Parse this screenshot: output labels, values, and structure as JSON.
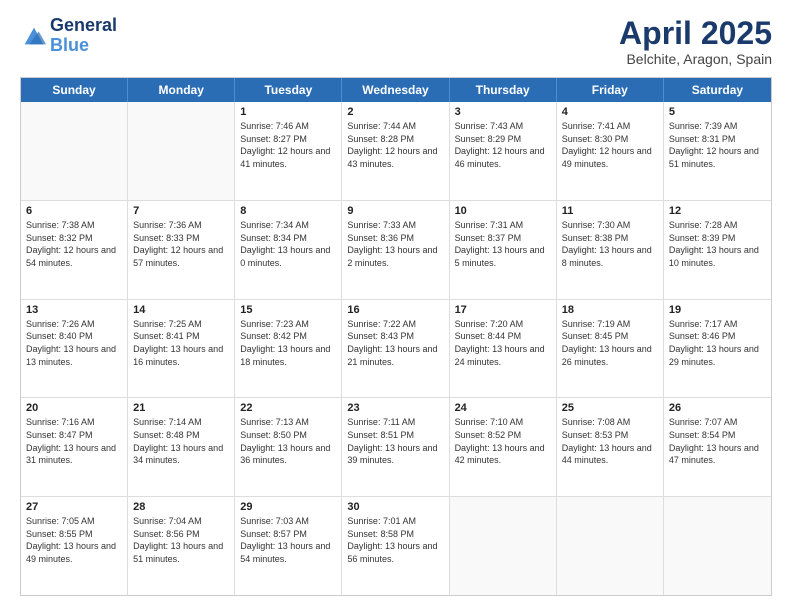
{
  "header": {
    "logo_general": "General",
    "logo_blue": "Blue",
    "title": "April 2025",
    "location": "Belchite, Aragon, Spain"
  },
  "calendar": {
    "days": [
      "Sunday",
      "Monday",
      "Tuesday",
      "Wednesday",
      "Thursday",
      "Friday",
      "Saturday"
    ],
    "rows": [
      [
        {
          "day": "",
          "info": ""
        },
        {
          "day": "",
          "info": ""
        },
        {
          "day": "1",
          "info": "Sunrise: 7:46 AM\nSunset: 8:27 PM\nDaylight: 12 hours and 41 minutes."
        },
        {
          "day": "2",
          "info": "Sunrise: 7:44 AM\nSunset: 8:28 PM\nDaylight: 12 hours and 43 minutes."
        },
        {
          "day": "3",
          "info": "Sunrise: 7:43 AM\nSunset: 8:29 PM\nDaylight: 12 hours and 46 minutes."
        },
        {
          "day": "4",
          "info": "Sunrise: 7:41 AM\nSunset: 8:30 PM\nDaylight: 12 hours and 49 minutes."
        },
        {
          "day": "5",
          "info": "Sunrise: 7:39 AM\nSunset: 8:31 PM\nDaylight: 12 hours and 51 minutes."
        }
      ],
      [
        {
          "day": "6",
          "info": "Sunrise: 7:38 AM\nSunset: 8:32 PM\nDaylight: 12 hours and 54 minutes."
        },
        {
          "day": "7",
          "info": "Sunrise: 7:36 AM\nSunset: 8:33 PM\nDaylight: 12 hours and 57 minutes."
        },
        {
          "day": "8",
          "info": "Sunrise: 7:34 AM\nSunset: 8:34 PM\nDaylight: 13 hours and 0 minutes."
        },
        {
          "day": "9",
          "info": "Sunrise: 7:33 AM\nSunset: 8:36 PM\nDaylight: 13 hours and 2 minutes."
        },
        {
          "day": "10",
          "info": "Sunrise: 7:31 AM\nSunset: 8:37 PM\nDaylight: 13 hours and 5 minutes."
        },
        {
          "day": "11",
          "info": "Sunrise: 7:30 AM\nSunset: 8:38 PM\nDaylight: 13 hours and 8 minutes."
        },
        {
          "day": "12",
          "info": "Sunrise: 7:28 AM\nSunset: 8:39 PM\nDaylight: 13 hours and 10 minutes."
        }
      ],
      [
        {
          "day": "13",
          "info": "Sunrise: 7:26 AM\nSunset: 8:40 PM\nDaylight: 13 hours and 13 minutes."
        },
        {
          "day": "14",
          "info": "Sunrise: 7:25 AM\nSunset: 8:41 PM\nDaylight: 13 hours and 16 minutes."
        },
        {
          "day": "15",
          "info": "Sunrise: 7:23 AM\nSunset: 8:42 PM\nDaylight: 13 hours and 18 minutes."
        },
        {
          "day": "16",
          "info": "Sunrise: 7:22 AM\nSunset: 8:43 PM\nDaylight: 13 hours and 21 minutes."
        },
        {
          "day": "17",
          "info": "Sunrise: 7:20 AM\nSunset: 8:44 PM\nDaylight: 13 hours and 24 minutes."
        },
        {
          "day": "18",
          "info": "Sunrise: 7:19 AM\nSunset: 8:45 PM\nDaylight: 13 hours and 26 minutes."
        },
        {
          "day": "19",
          "info": "Sunrise: 7:17 AM\nSunset: 8:46 PM\nDaylight: 13 hours and 29 minutes."
        }
      ],
      [
        {
          "day": "20",
          "info": "Sunrise: 7:16 AM\nSunset: 8:47 PM\nDaylight: 13 hours and 31 minutes."
        },
        {
          "day": "21",
          "info": "Sunrise: 7:14 AM\nSunset: 8:48 PM\nDaylight: 13 hours and 34 minutes."
        },
        {
          "day": "22",
          "info": "Sunrise: 7:13 AM\nSunset: 8:50 PM\nDaylight: 13 hours and 36 minutes."
        },
        {
          "day": "23",
          "info": "Sunrise: 7:11 AM\nSunset: 8:51 PM\nDaylight: 13 hours and 39 minutes."
        },
        {
          "day": "24",
          "info": "Sunrise: 7:10 AM\nSunset: 8:52 PM\nDaylight: 13 hours and 42 minutes."
        },
        {
          "day": "25",
          "info": "Sunrise: 7:08 AM\nSunset: 8:53 PM\nDaylight: 13 hours and 44 minutes."
        },
        {
          "day": "26",
          "info": "Sunrise: 7:07 AM\nSunset: 8:54 PM\nDaylight: 13 hours and 47 minutes."
        }
      ],
      [
        {
          "day": "27",
          "info": "Sunrise: 7:05 AM\nSunset: 8:55 PM\nDaylight: 13 hours and 49 minutes."
        },
        {
          "day": "28",
          "info": "Sunrise: 7:04 AM\nSunset: 8:56 PM\nDaylight: 13 hours and 51 minutes."
        },
        {
          "day": "29",
          "info": "Sunrise: 7:03 AM\nSunset: 8:57 PM\nDaylight: 13 hours and 54 minutes."
        },
        {
          "day": "30",
          "info": "Sunrise: 7:01 AM\nSunset: 8:58 PM\nDaylight: 13 hours and 56 minutes."
        },
        {
          "day": "",
          "info": ""
        },
        {
          "day": "",
          "info": ""
        },
        {
          "day": "",
          "info": ""
        }
      ]
    ]
  }
}
